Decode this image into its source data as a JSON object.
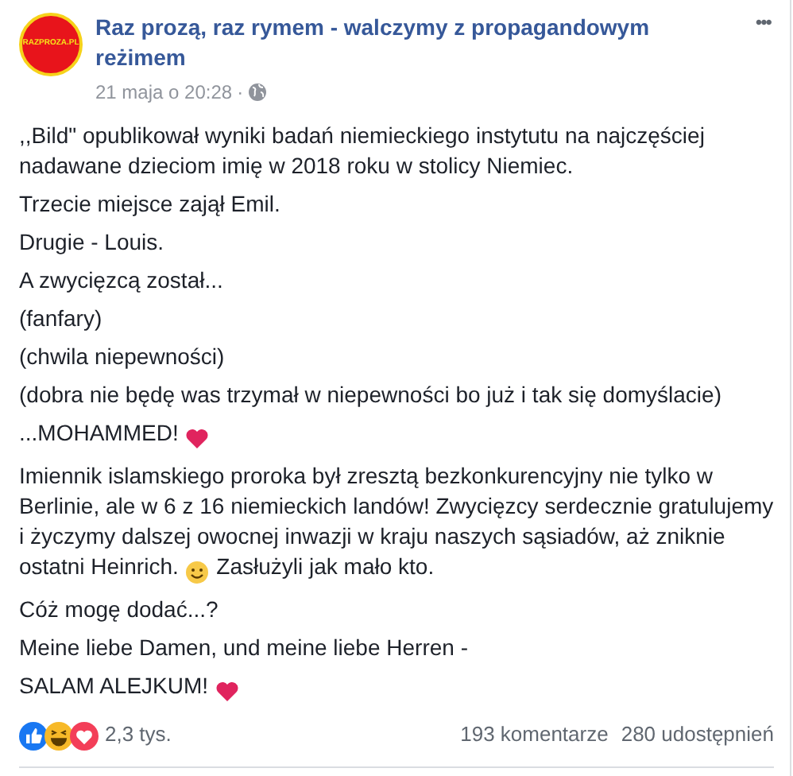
{
  "post": {
    "logo_text": "RAZPROZA.PL",
    "author": "Raz prozą, raz rymem - walczymy z propagandowym reżimem",
    "time": "21 maja o 20:28",
    "separator": "·",
    "menu": "•••",
    "paragraphs": [
      [
        {
          "kind": "text",
          "text": ",,Bild\" opublikował wyniki badań niemieckiego instytutu na najczęściej nadawane dzieciom imię w 2018 roku w stolicy Niemiec."
        }
      ],
      [
        {
          "kind": "text",
          "text": "Trzecie miejsce zajął Emil."
        }
      ],
      [
        {
          "kind": "text",
          "text": "Drugie - Louis."
        }
      ],
      [
        {
          "kind": "text",
          "text": "A zwycięzcą został..."
        }
      ],
      [
        {
          "kind": "text",
          "text": "(fanfary)"
        }
      ],
      [
        {
          "kind": "text",
          "text": "(chwila niepewności)"
        }
      ],
      [
        {
          "kind": "text",
          "text": "(dobra nie będę was trzymał w niepewności bo już i tak się domyślacie)"
        }
      ],
      [
        {
          "kind": "text",
          "text": "...MOHAMMED! "
        },
        {
          "kind": "heart"
        }
      ],
      [
        {
          "kind": "text",
          "text": "Imiennik islamskiego proroka był zresztą bezkonkurencyjny nie tylko w Berlinie, ale w 6 z 16 niemieckich landów! Zwycięzcy serdecznie gratulujemy i życzymy dalszej owocnej inwazji w kraju naszych sąsiadów, aż zniknie ostatni Heinrich. "
        },
        {
          "kind": "smile"
        },
        {
          "kind": "text",
          "text": " Zasłużyli jak mało kto."
        }
      ],
      [
        {
          "kind": "text",
          "text": "Cóż mogę dodać...?"
        }
      ],
      [
        {
          "kind": "text",
          "text": "Meine liebe Damen, und meine liebe Herren -"
        }
      ],
      [
        {
          "kind": "text",
          "text": "SALAM ALEJKUM! "
        },
        {
          "kind": "heart"
        }
      ]
    ],
    "reactions": [
      {
        "kind": "like"
      },
      {
        "kind": "haha"
      },
      {
        "kind": "love"
      }
    ],
    "reaction_count": "2,3 tys.",
    "comments": "193 komentarze",
    "shares": "280 udostępnień"
  }
}
